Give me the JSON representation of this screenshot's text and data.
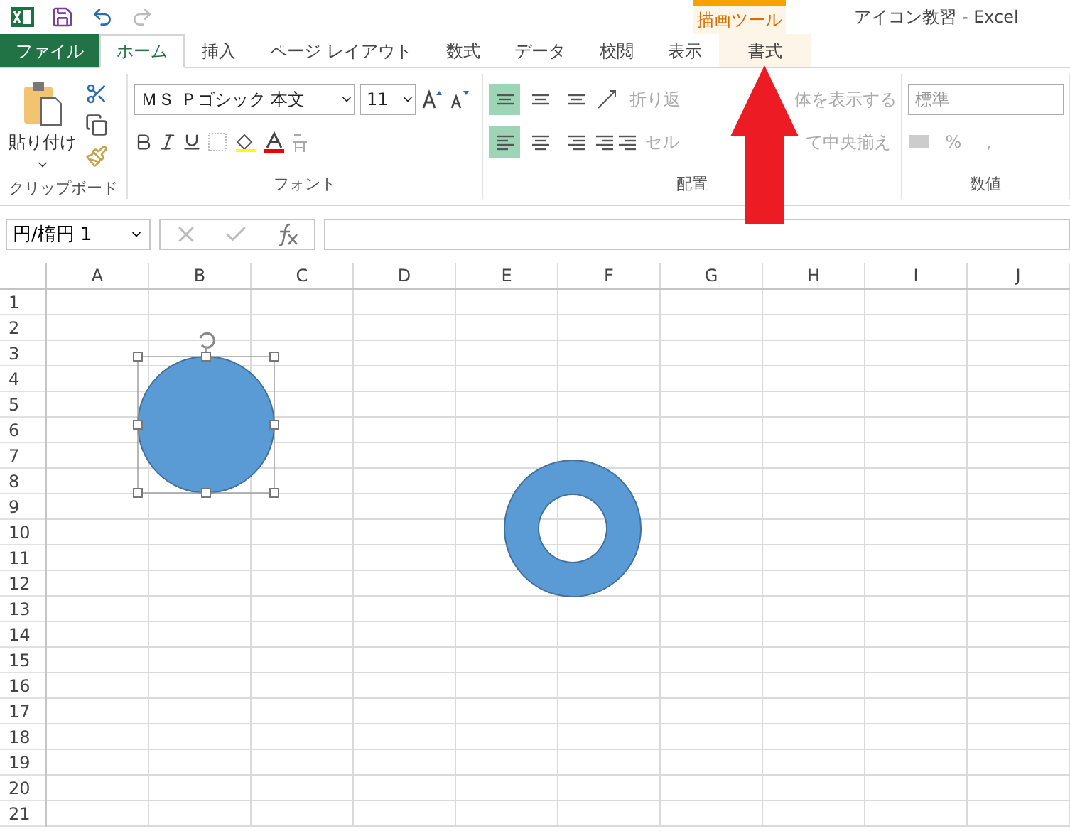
{
  "window": {
    "title": "アイコン教習 - Excel"
  },
  "contextual_group": {
    "label": "描画ツール"
  },
  "tabs": [
    {
      "label": "ファイル",
      "kind": "file",
      "selected": false
    },
    {
      "label": "ホーム",
      "kind": "normal",
      "selected": true
    },
    {
      "label": "挿入",
      "kind": "normal",
      "selected": false
    },
    {
      "label": "ページ レイアウト",
      "kind": "normal",
      "selected": false
    },
    {
      "label": "数式",
      "kind": "normal",
      "selected": false
    },
    {
      "label": "データ",
      "kind": "normal",
      "selected": false
    },
    {
      "label": "校閲",
      "kind": "normal",
      "selected": false
    },
    {
      "label": "表示",
      "kind": "normal",
      "selected": false
    },
    {
      "label": "書式",
      "kind": "contextual",
      "selected": false
    }
  ],
  "clipboard": {
    "paste": "貼り付け",
    "label": "クリップボード"
  },
  "font": {
    "name": "ＭＳ Ｐゴシック 本文",
    "size": "11",
    "label": "フォント"
  },
  "alignment": {
    "vertical": [
      {
        "selected": true
      },
      {
        "selected": false
      },
      {
        "selected": false
      }
    ],
    "horizontal": [
      {
        "selected": true
      },
      {
        "selected": false
      },
      {
        "selected": false
      }
    ],
    "wrap_text": [
      "折り返",
      "体を表示する"
    ],
    "merge": [
      "セル",
      "て中央揃え"
    ],
    "label": "配置"
  },
  "number": {
    "format": "標準",
    "percent": "%",
    "comma": ",",
    "label": "数値"
  },
  "name_box": {
    "value": "円/楕円 1"
  },
  "sheet": {
    "columns": [
      "A",
      "B",
      "C",
      "D",
      "E",
      "F",
      "G",
      "H",
      "I",
      "J"
    ],
    "rows": [
      "1",
      "2",
      "3",
      "4",
      "5",
      "6",
      "7",
      "8",
      "9",
      "10",
      "11",
      "12",
      "13",
      "14",
      "15",
      "16",
      "17",
      "18",
      "19",
      "20",
      "21"
    ],
    "shapes": [
      {
        "kind": "circle",
        "selected": true
      },
      {
        "kind": "donut",
        "selected": false
      }
    ]
  }
}
